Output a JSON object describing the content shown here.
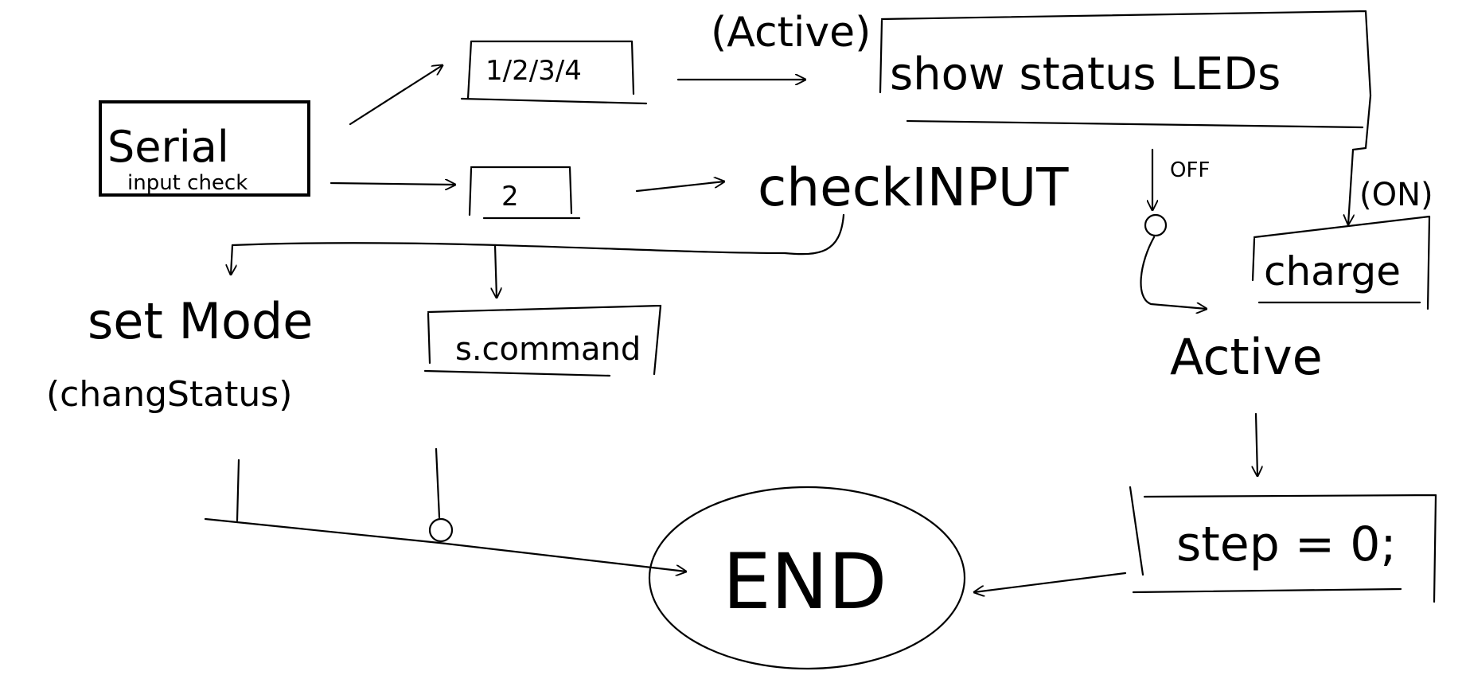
{
  "nodes": {
    "serial": {
      "line1": "Serial",
      "line2": "input check"
    },
    "box_1": "1/2/3/4",
    "box_2": "2",
    "top_label": "(Active)",
    "show_status": "show status LEDs",
    "check_input": "checkINPUT",
    "set_mode": "set Mode",
    "change_status": "(changStatus)",
    "s_command": "s.command",
    "charge": "charge",
    "active": "Active",
    "step": "step = 0;",
    "end": "END"
  },
  "edge_labels": {
    "off": "OFF",
    "on": "(ON)"
  }
}
